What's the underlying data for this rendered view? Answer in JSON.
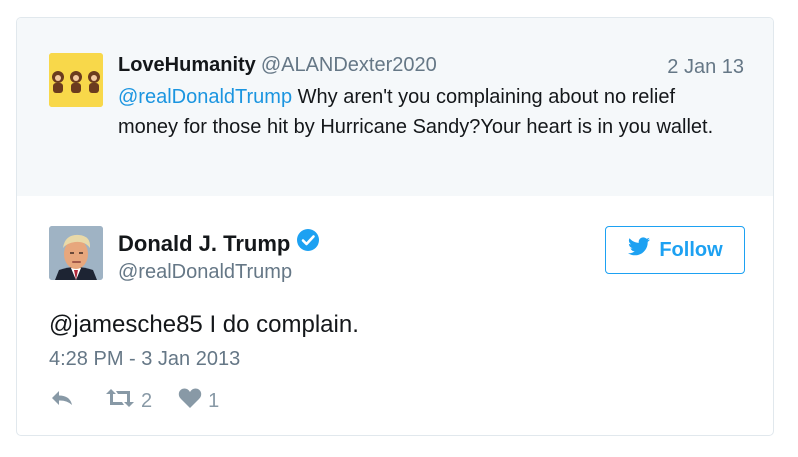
{
  "quoted_tweet": {
    "name": "LoveHumanity",
    "handle": "@ALANDexter2020",
    "date": "2 Jan 13",
    "mention": "@realDonaldTrump",
    "text": " Why aren't you complaining about no relief money for those hit by Hurricane Sandy?Your heart is in you wallet."
  },
  "tweet": {
    "name": "Donald J. Trump",
    "handle": "@realDonaldTrump",
    "verified_icon": "verified-badge-icon",
    "follow_label": "Follow",
    "text": "@jamesche85 I do complain.",
    "timestamp": "4:28 PM - 3 Jan 2013",
    "retweet_count": "2",
    "like_count": "1"
  },
  "colors": {
    "link": "#1b95e0",
    "accent": "#1da1f2",
    "muted": "#657786",
    "quoted_bg": "#f5f8fa"
  }
}
